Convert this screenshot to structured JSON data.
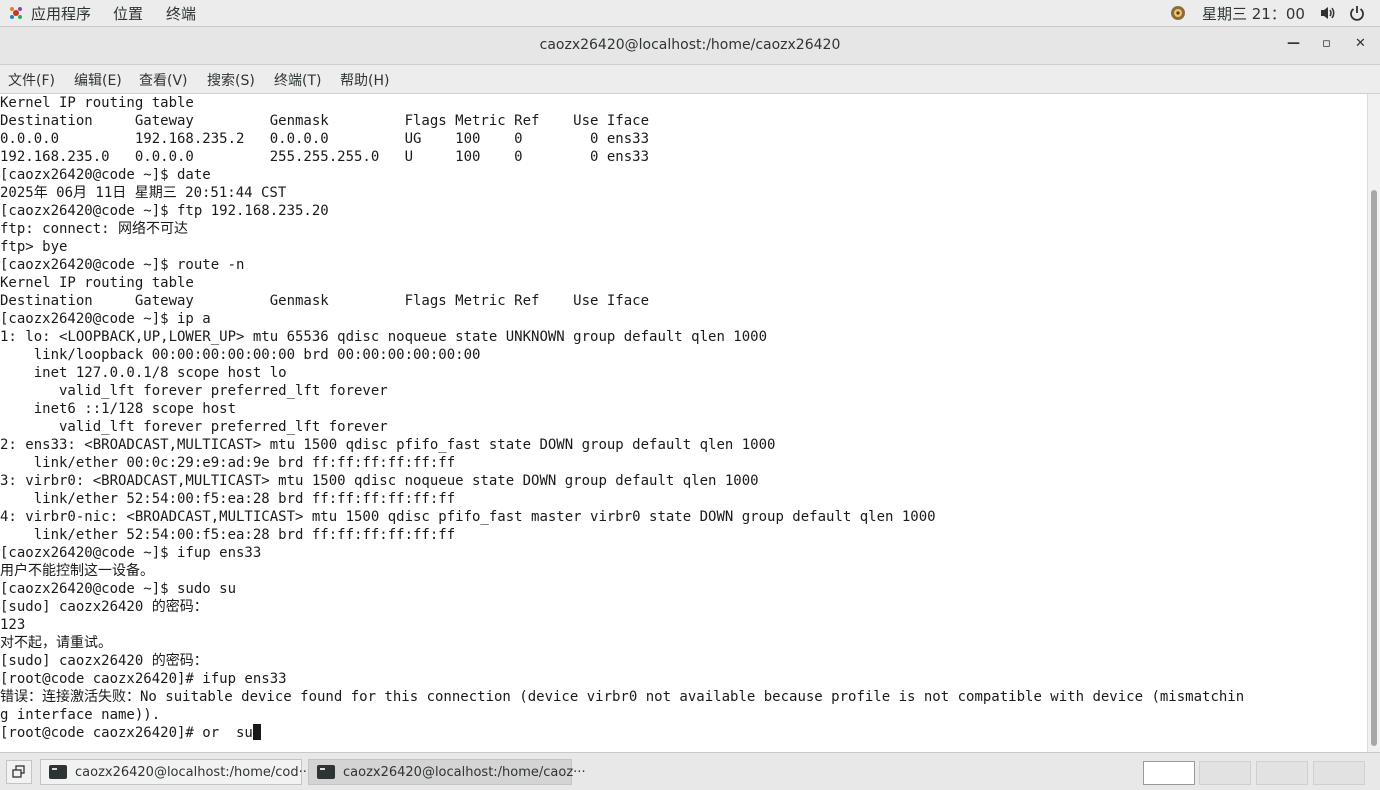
{
  "topbar": {
    "applications": "应用程序",
    "places": "位置",
    "terminal": "终端",
    "clock": "星期三 21：00"
  },
  "window": {
    "title": "caozx26420@localhost:/home/caozx26420",
    "minimize": "—",
    "maximize": "▫",
    "close": "✕"
  },
  "menubar": {
    "items": [
      "文件(F)",
      "编辑(E)",
      "查看(V)",
      "搜索(S)",
      "终端(T)",
      "帮助(H)"
    ]
  },
  "terminal": {
    "lines": [
      "Kernel IP routing table",
      "Destination     Gateway         Genmask         Flags Metric Ref    Use Iface",
      "0.0.0.0         192.168.235.2   0.0.0.0         UG    100    0        0 ens33",
      "192.168.235.0   0.0.0.0         255.255.255.0   U     100    0        0 ens33",
      "[caozx26420@code ~]$ date",
      "2025年 06月 11日 星期三 20:51:44 CST",
      "[caozx26420@code ~]$ ftp 192.168.235.20",
      "ftp: connect: 网络不可达",
      "ftp> bye",
      "[caozx26420@code ~]$ route -n",
      "Kernel IP routing table",
      "Destination     Gateway         Genmask         Flags Metric Ref    Use Iface",
      "[caozx26420@code ~]$ ip a",
      "1: lo: <LOOPBACK,UP,LOWER_UP> mtu 65536 qdisc noqueue state UNKNOWN group default qlen 1000",
      "    link/loopback 00:00:00:00:00:00 brd 00:00:00:00:00:00",
      "    inet 127.0.0.1/8 scope host lo",
      "       valid_lft forever preferred_lft forever",
      "    inet6 ::1/128 scope host",
      "       valid_lft forever preferred_lft forever",
      "2: ens33: <BROADCAST,MULTICAST> mtu 1500 qdisc pfifo_fast state DOWN group default qlen 1000",
      "    link/ether 00:0c:29:e9:ad:9e brd ff:ff:ff:ff:ff:ff",
      "3: virbr0: <BROADCAST,MULTICAST> mtu 1500 qdisc noqueue state DOWN group default qlen 1000",
      "    link/ether 52:54:00:f5:ea:28 brd ff:ff:ff:ff:ff:ff",
      "4: virbr0-nic: <BROADCAST,MULTICAST> mtu 1500 qdisc pfifo_fast master virbr0 state DOWN group default qlen 1000",
      "    link/ether 52:54:00:f5:ea:28 brd ff:ff:ff:ff:ff:ff",
      "[caozx26420@code ~]$ ifup ens33",
      "用户不能控制这一设备。",
      "[caozx26420@code ~]$ sudo su",
      "[sudo] caozx26420 的密码：",
      "123",
      "对不起，请重试。",
      "[sudo] caozx26420 的密码：",
      "[root@code caozx26420]# ifup ens33",
      "错误：连接激活失败：No suitable device found for this connection (device virbr0 not available because profile is not compatible with device (mismatchin",
      "g interface name)).",
      "[root@code caozx26420]# or  su"
    ]
  },
  "taskbar": {
    "tasks": [
      {
        "label": "caozx26420@localhost:/home/cod···"
      },
      {
        "label": "caozx26420@localhost:/home/caoz···"
      }
    ]
  },
  "icons": {
    "apps": "apps-menu-icon",
    "notify": "notification-icon",
    "volume": "volume-icon",
    "power": "power-icon",
    "show_desktop": "show-desktop-icon",
    "terminal": "terminal-icon"
  }
}
